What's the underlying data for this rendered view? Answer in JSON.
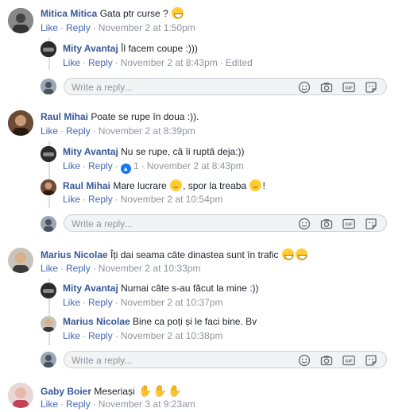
{
  "actions": {
    "like": "Like",
    "reply": "Reply",
    "edited": "Edited"
  },
  "reply_placeholder": "Write a reply...",
  "threads": [
    {
      "author": "Mitica Mitica",
      "text": "Gata ptr curse ?",
      "time": "November 2 at 1:50pm",
      "replies": [
        {
          "author": "Mity Avantaj",
          "text": "Îl facem coupe :)))",
          "time": "November 2 at 8:43pm",
          "edited": true
        }
      ]
    },
    {
      "author": "Raul Mihai",
      "text": "Poate se rupe în doua :)).",
      "time": "November 2 at 8:39pm",
      "replies": [
        {
          "author": "Mity Avantaj",
          "text": "Nu se rupe, că îi ruptă deja:))",
          "time": "November 2 at 8:43pm",
          "likes": "1"
        },
        {
          "author": "Raul Mihai",
          "text_a": "Mare lucrare",
          "text_b": ", spor la treaba",
          "text_c": "!",
          "time": "November 2 at 10:54pm"
        }
      ]
    },
    {
      "author": "Marius Nicolae",
      "text": "Îți dai seama câte dinastea sunt în trafic",
      "time": "November 2 at 10:33pm",
      "replies": [
        {
          "author": "Mity Avantaj",
          "text": "Numai câte s-au făcut la mine :))",
          "time": "November 2 at 10:37pm"
        },
        {
          "author": "Marius Nicolae",
          "text": "Bine ca poți și le faci bine. Bv",
          "time": "November 2 at 10:38pm"
        }
      ]
    },
    {
      "author": "Gaby Boier",
      "text": "Meseriași",
      "time": "November 3 at 9:23am",
      "replies": []
    }
  ],
  "colors": {
    "name": "#385898",
    "action": "#4267b2",
    "meta": "#90949c"
  }
}
